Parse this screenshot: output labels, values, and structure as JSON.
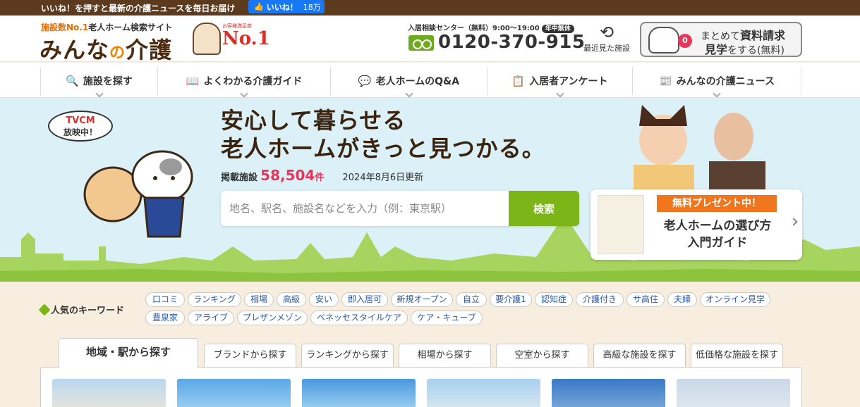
{
  "topbar": {
    "message": "いいね！を押すと最新の介護ニュースを毎日お届け",
    "like_label": "いいね！",
    "like_count": "18万"
  },
  "header": {
    "tagline_prefix": "施設数No.1",
    "tagline_suffix": "老人ホーム検索サイト",
    "site_name_a": "みんな",
    "site_name_b": "の",
    "site_name_c": "介護",
    "badge_text": "No.1",
    "badge_small": "お客様満足度",
    "tel_label": "入居相談センター（無料）9:00～19:00",
    "tel_tag": "年中無休",
    "tel_number": "0120-370-915",
    "recent_label": "最近見た施設",
    "request_count": "0",
    "request_line1_a": "まとめて",
    "request_line1_b": "資料請求",
    "request_line2_a": "見学",
    "request_line2_b": "をする(無料)"
  },
  "nav": [
    {
      "label": "施設を探す",
      "icon": "search-icon"
    },
    {
      "label": "よくわかる介護ガイド",
      "icon": "book-icon"
    },
    {
      "label": "老人ホームのQ&A",
      "icon": "chat-icon"
    },
    {
      "label": "入居者アンケート",
      "icon": "clipboard-icon"
    },
    {
      "label": "みんなの介護ニュース",
      "icon": "news-icon"
    }
  ],
  "hero": {
    "tvcm_line1": "TVCM",
    "tvcm_line2": "放映中！",
    "title_line1": "安心して暮らせる",
    "title_line2": "老人ホームがきっと見つかる。",
    "count_label": "掲載施設",
    "count_value": "58,504",
    "count_unit": "件",
    "updated": "2024年8月6日更新",
    "search_placeholder": "地名、駅名、施設名などを入力（例：東京駅）",
    "search_button": "検索",
    "present_ribbon": "無料プレゼント中！",
    "present_title_line1": "老人ホームの選び方",
    "present_title_line2": "入門ガイド"
  },
  "keywords": {
    "label": "人気のキーワード",
    "items": [
      "口コミ",
      "ランキング",
      "相場",
      "高級",
      "安い",
      "即入居可",
      "新規オープン",
      "自立",
      "要介護1",
      "認知症",
      "介護付き",
      "サ高住",
      "夫婦",
      "オンライン見学",
      "豊泉家",
      "アライブ",
      "プレザンメゾン",
      "ベネッセスタイルケア",
      "ケア・キューブ"
    ]
  },
  "tabs": {
    "items": [
      "地域・駅から探す",
      "ブランドから探す",
      "ランキングから探す",
      "相場から探す",
      "空室から探す",
      "高級な施設を探す",
      "低価格な施設を探す"
    ],
    "active_index": 0
  },
  "colors": {
    "topbar": "#5c3a1e",
    "accent_green": "#7cb518",
    "accent_pink": "#e8365a",
    "accent_orange": "#f0761e",
    "hero_sky": "#dcf0f8",
    "page_bg": "#f7eee0"
  }
}
